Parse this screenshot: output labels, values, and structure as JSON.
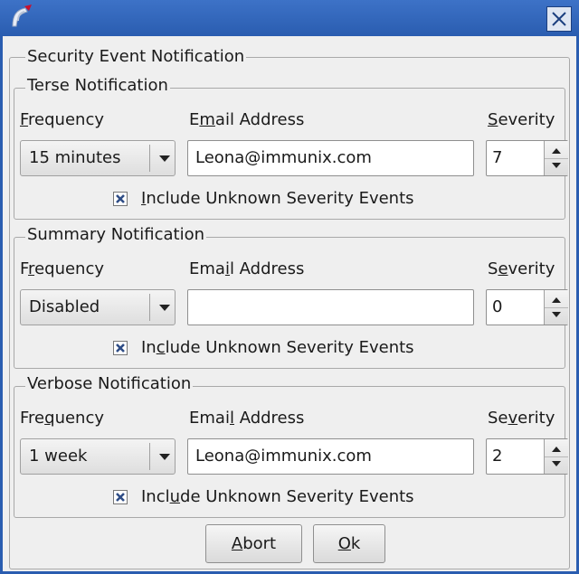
{
  "window": {
    "app_icon": "app-logo-icon",
    "close_icon": "close-icon"
  },
  "outer_group": {
    "title": "Security Event Notification"
  },
  "groups": [
    {
      "title": "Terse Notification",
      "frequency_label": {
        "before": "",
        "mnemonic": "F",
        "after": "requency"
      },
      "email_label": {
        "before": "E",
        "mnemonic": "m",
        "after": "ail Address"
      },
      "severity_label": {
        "before": "",
        "mnemonic": "S",
        "after": "everity"
      },
      "frequency_value": "15 minutes",
      "email_value": "Leona@immunix.com",
      "severity_value": "7",
      "checkbox_checked": true,
      "checkbox_label": {
        "before": "",
        "mnemonic": "I",
        "after": "nclude Unknown Severity Events"
      }
    },
    {
      "title": "Summary Notification",
      "frequency_label": {
        "before": "F",
        "mnemonic": "r",
        "after": "equency"
      },
      "email_label": {
        "before": "Ema",
        "mnemonic": "i",
        "after": "l Address"
      },
      "severity_label": {
        "before": "S",
        "mnemonic": "e",
        "after": "verity"
      },
      "frequency_value": "Disabled",
      "email_value": "",
      "severity_value": "0",
      "checkbox_checked": true,
      "checkbox_label": {
        "before": "In",
        "mnemonic": "c",
        "after": "lude Unknown Severity Events"
      }
    },
    {
      "title": "Verbose Notification",
      "frequency_label": {
        "before": "Fre",
        "mnemonic": "q",
        "after": "uency"
      },
      "email_label": {
        "before": "Emai",
        "mnemonic": "l",
        "after": " Address"
      },
      "severity_label": {
        "before": "Se",
        "mnemonic": "v",
        "after": "erity"
      },
      "frequency_value": "1 week",
      "email_value": "Leona@immunix.com",
      "severity_value": "2",
      "checkbox_checked": true,
      "checkbox_label": {
        "before": "Incl",
        "mnemonic": "u",
        "after": "de Unknown Severity Events"
      }
    }
  ],
  "buttons": {
    "abort": {
      "before": "",
      "mnemonic": "A",
      "after": "bort"
    },
    "ok": {
      "before": "",
      "mnemonic": "O",
      "after": "k"
    }
  },
  "colors": {
    "titlebar": "#2a5db0",
    "background": "#efefef",
    "check_mark": "#2f4d86"
  }
}
